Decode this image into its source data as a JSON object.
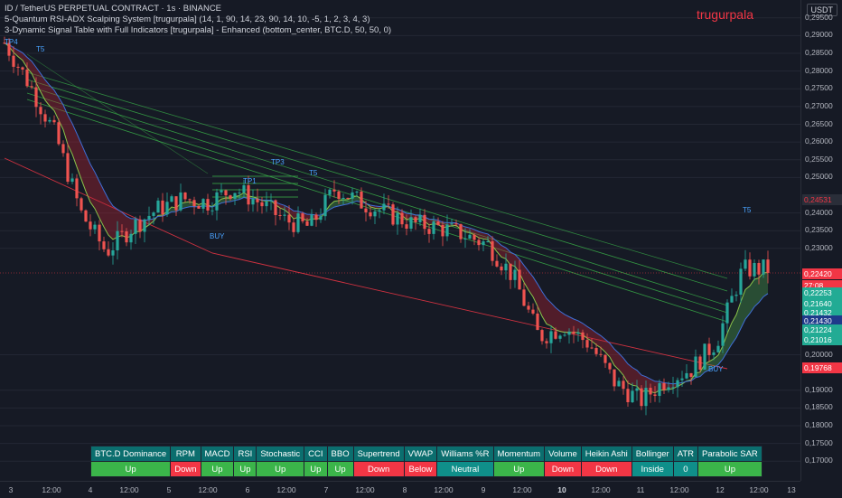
{
  "header": {
    "line1": "ID / TetherUS PERPETUAL CONTRACT · 1s · BINANCE",
    "line2": "5-Quantum RSI-ADX Scalping System [trugurpala] (14, 1, 90, 14, 23, 90, 14, 10, -5, 1, 2, 3, 4, 3)",
    "line3": "3-Dynamic Signal Table with Full Indicators [trugurpala] - Enhanced (bottom_center, BTC.D, 50, 50, 0)"
  },
  "brand": "trugurpala",
  "currency": "USDT",
  "price_axis": {
    "ticks": [
      "0,29500",
      "0,29000",
      "0,28500",
      "0,28000",
      "0,27500",
      "0,27000",
      "0,26500",
      "0,26000",
      "0,25500",
      "0,25000",
      "0,24000",
      "0,23500",
      "0,23000",
      "0,20000",
      "0,19000",
      "0,18500",
      "0,18000",
      "0,17500",
      "0,17000"
    ],
    "tags": [
      {
        "text": "0,24531",
        "color": "#ffffff",
        "bg": "#2a2e39",
        "fg": "#f23645"
      },
      {
        "text": "0,22420",
        "color": "#f23645",
        "bg": "#f23645",
        "fg": "#ffffff"
      },
      {
        "text": "27:08",
        "color": "#f23645",
        "bg": "#f23645",
        "fg": "#ffffff"
      },
      {
        "text": "0,22253",
        "color": "#3bb54a",
        "bg": "#22ab94",
        "fg": "#ffffff"
      },
      {
        "text": "0,21640",
        "color": "#3bb54a",
        "bg": "#22ab94",
        "fg": "#ffffff"
      },
      {
        "text": "0,21432",
        "color": "#3bb54a",
        "bg": "#22ab94",
        "fg": "#ffffff"
      },
      {
        "text": "0,21430",
        "color": "#2962ff",
        "bg": "#1e3a8a",
        "fg": "#ffffff"
      },
      {
        "text": "0,21224",
        "color": "#3bb54a",
        "bg": "#22ab94",
        "fg": "#ffffff"
      },
      {
        "text": "0,21016",
        "color": "#3bb54a",
        "bg": "#22ab94",
        "fg": "#ffffff"
      },
      {
        "text": "0,19768",
        "color": "#f23645",
        "bg": "#f23645",
        "fg": "#ffffff"
      }
    ]
  },
  "time_axis": [
    "3",
    "12:00",
    "4",
    "12:00",
    "5",
    "12:00",
    "6",
    "12:00",
    "7",
    "12:00",
    "8",
    "12:00",
    "9",
    "12:00",
    "10",
    "12:00",
    "11",
    "12:00",
    "12",
    "12:00",
    "13"
  ],
  "signals": {
    "buy1": "BUY",
    "buy2": "BUY",
    "tp1": "TP1",
    "tp3": "TP3",
    "t5a": "T5",
    "t5b": "T5",
    "t5c": "T5",
    "tp4": "TP4"
  },
  "table": {
    "headers": [
      "BTC.D Dominance",
      "RPM",
      "MACD",
      "RSI",
      "Stochastic",
      "CCI",
      "BBO",
      "Supertrend",
      "VWAP",
      "Williams %R",
      "Momentum",
      "Volume",
      "Heikin Ashi",
      "Bollinger",
      "ATR",
      "Parabolic SAR"
    ],
    "values": [
      "Up",
      "Down",
      "Up",
      "Up",
      "Up",
      "Up",
      "Up",
      "Down",
      "Below",
      "Neutral",
      "Up",
      "Down",
      "Down",
      "Inside",
      "0",
      "Up"
    ],
    "states": [
      "up",
      "down",
      "up",
      "up",
      "up",
      "up",
      "up",
      "down",
      "down",
      "neutral",
      "up",
      "down",
      "down",
      "neutral",
      "neutral",
      "up"
    ]
  },
  "chart_data": {
    "type": "candlestick",
    "symbol": "ID / TetherUS PERPETUAL CONTRACT",
    "interval": "1s",
    "y_range": [
      0.1675,
      0.2975
    ],
    "last_price": 0.2242,
    "x_days": [
      "3",
      "4",
      "5",
      "6",
      "7",
      "8",
      "9",
      "10",
      "11",
      "12",
      "13"
    ],
    "close_path": [
      0.288,
      0.276,
      0.262,
      0.24,
      0.229,
      0.236,
      0.241,
      0.244,
      0.243,
      0.247,
      0.243,
      0.238,
      0.236,
      0.247,
      0.243,
      0.24,
      0.237,
      0.236,
      0.234,
      0.231,
      0.222,
      0.205,
      0.208,
      0.203,
      0.192,
      0.187,
      0.193,
      0.196,
      0.204,
      0.224,
      0.2242
    ]
  }
}
